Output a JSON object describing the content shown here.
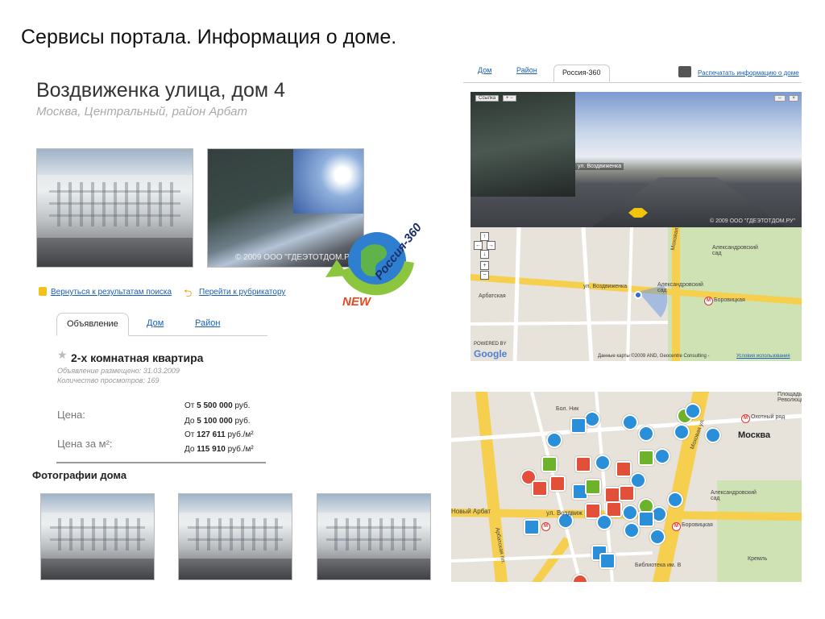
{
  "slide": {
    "title": "Сервисы портала. Информация о доме."
  },
  "listing": {
    "address": "Воздвиженка улица, дом 4",
    "location": "Москва, Центральный, район Арбат",
    "street_photo_caption": "© 2009 ООО \"ГДЕЭТОТДОМ.РУ\"",
    "logo": {
      "new": "NEW",
      "name": "Россия-360"
    },
    "nav": {
      "back": "Вернуться к результатам поиска",
      "rubricator": "Перейти к рубрикатору"
    },
    "tabs": [
      "Объявление",
      "Дом",
      "Район"
    ],
    "active_tab": "Объявление",
    "flat_title": "2-х комнатная квартира",
    "posted": "Объявление размещено: 31.03.2009",
    "views": "Количество просмотров: 169",
    "price": {
      "label": "Цена:",
      "from_prefix": "От",
      "from_value": "5 500 000",
      "from_unit": "руб.",
      "to_prefix": "До",
      "to_value": "5 100 000",
      "to_unit": "руб."
    },
    "price_m2": {
      "label": "Цена за м²:",
      "from_prefix": "От",
      "from_value": "127 611",
      "from_unit": "руб./м²",
      "to_prefix": "До",
      "to_value": "115 910",
      "to_unit": "руб./м²"
    },
    "photos_title": "Фотографии дома"
  },
  "panorama": {
    "tabs": [
      "Дом",
      "Район",
      "Россия-360"
    ],
    "active_tab": "Россия-360",
    "print_link": "Распечатать информацию о доме",
    "controls": {
      "link": "Ссылка",
      "zoom": "+ −",
      "expand": "⇔",
      "close": "×"
    },
    "label": "ул. Воздвиженка",
    "caption": "© 2009 ООО \"ГДЕЭТОТДОМ.РУ\""
  },
  "map1": {
    "labels": [
      "Александровский сад",
      "ул. Воздвиженка",
      "Александровский сад",
      "Боровицкая",
      "Арбатская",
      "Моховая ул."
    ],
    "copyright": "Данные карты ©2009 AND, Geocentre Consulting -",
    "terms": "Условия использования",
    "powered": "POWERED BY",
    "google": "Google"
  },
  "map2": {
    "labels": [
      "Москва",
      "Охотный ряд",
      "Площадь Революции",
      "Александровский сад",
      "Боровицкая",
      "Кремль",
      "Новый Арбат",
      "ул. Воздвиж",
      "Арбатская пл.",
      "Бол. Ник",
      "Моховая ул.",
      "Библиотека им. В"
    ]
  },
  "colors": {
    "link": "#1a5fb4",
    "accent_orange": "#e34a1f",
    "poi_blue": "#2a8fd8"
  }
}
